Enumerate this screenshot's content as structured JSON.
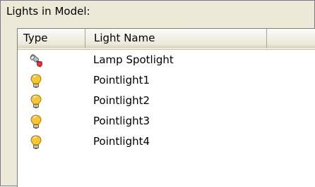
{
  "panel": {
    "title": "Lights in Model:"
  },
  "list": {
    "columns": [
      {
        "label": "Type"
      },
      {
        "label": "Light Name"
      },
      {
        "label": ""
      }
    ],
    "rows": [
      {
        "type_icon": "spotlight-icon",
        "name": "Lamp Spotlight"
      },
      {
        "type_icon": "pointlight-bulb-icon",
        "name": "Pointlight1"
      },
      {
        "type_icon": "pointlight-bulb-icon",
        "name": "Pointlight2"
      },
      {
        "type_icon": "pointlight-bulb-icon",
        "name": "Pointlight3"
      },
      {
        "type_icon": "pointlight-bulb-icon",
        "name": "Pointlight4"
      }
    ]
  },
  "colors": {
    "panel_bg": "#ece9d8",
    "header_bg": "#ebeadb",
    "bulb_yellow": "#f6c63a",
    "spotlight_red": "#d8242a"
  }
}
